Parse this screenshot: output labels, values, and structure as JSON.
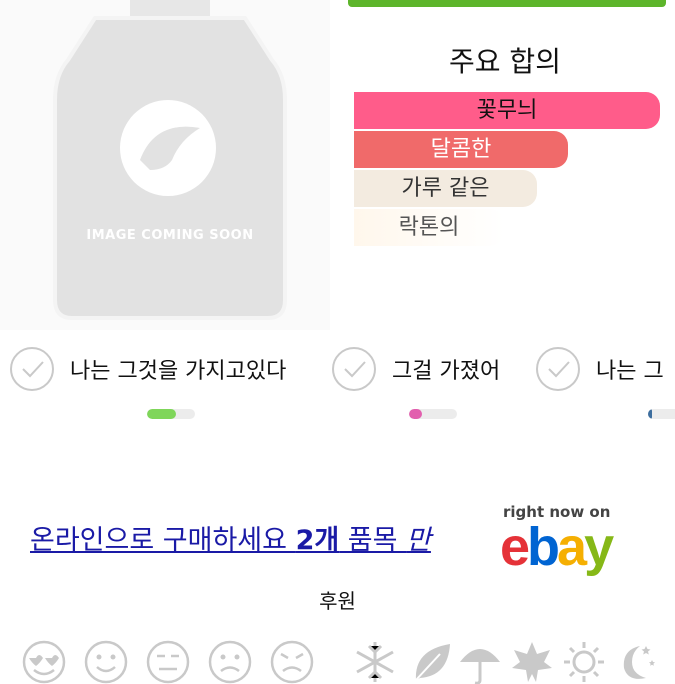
{
  "product": {
    "image_text": "IMAGE COMING SOON"
  },
  "accords": {
    "title": "주요 합의",
    "items": [
      {
        "label": "꽃무늬",
        "strength": 1.0,
        "color": "#ff5c8a"
      },
      {
        "label": "달콤한",
        "strength": 0.7,
        "color": "#f06a6a"
      },
      {
        "label": "가루 같은",
        "strength": 0.6,
        "color": "#f3ebe0"
      },
      {
        "label": "락톤의",
        "strength": 0.49,
        "color": "#fff7ec"
      }
    ]
  },
  "ownership": {
    "items": [
      {
        "label": "나는 그것을 가지고있다",
        "vote_fraction": 0.6,
        "color": "#7fd65a"
      },
      {
        "label": "그걸 가졌어",
        "vote_fraction": 0.28,
        "color": "#e25fae"
      },
      {
        "label": "나는 그",
        "vote_fraction": 0.15,
        "color": "#3d6e9e"
      }
    ]
  },
  "ad": {
    "link_part1": "온라인으로 구매하세요 ",
    "link_bold": "2개",
    "link_part2": " 품목 ",
    "link_italic": "만",
    "ebay_tagline": "right now on",
    "ebay_letters": [
      "e",
      "b",
      "a",
      "y"
    ],
    "sponsored_label": "후원"
  },
  "rating_icons": [
    "love-face-icon",
    "smile-face-icon",
    "neutral-face-icon",
    "sad-face-icon",
    "angry-face-icon"
  ],
  "season_icons": [
    "snowflake-icon",
    "leaf-icon",
    "umbrella-icon",
    "maple-leaf-icon",
    "sun-icon",
    "moon-stars-icon"
  ]
}
